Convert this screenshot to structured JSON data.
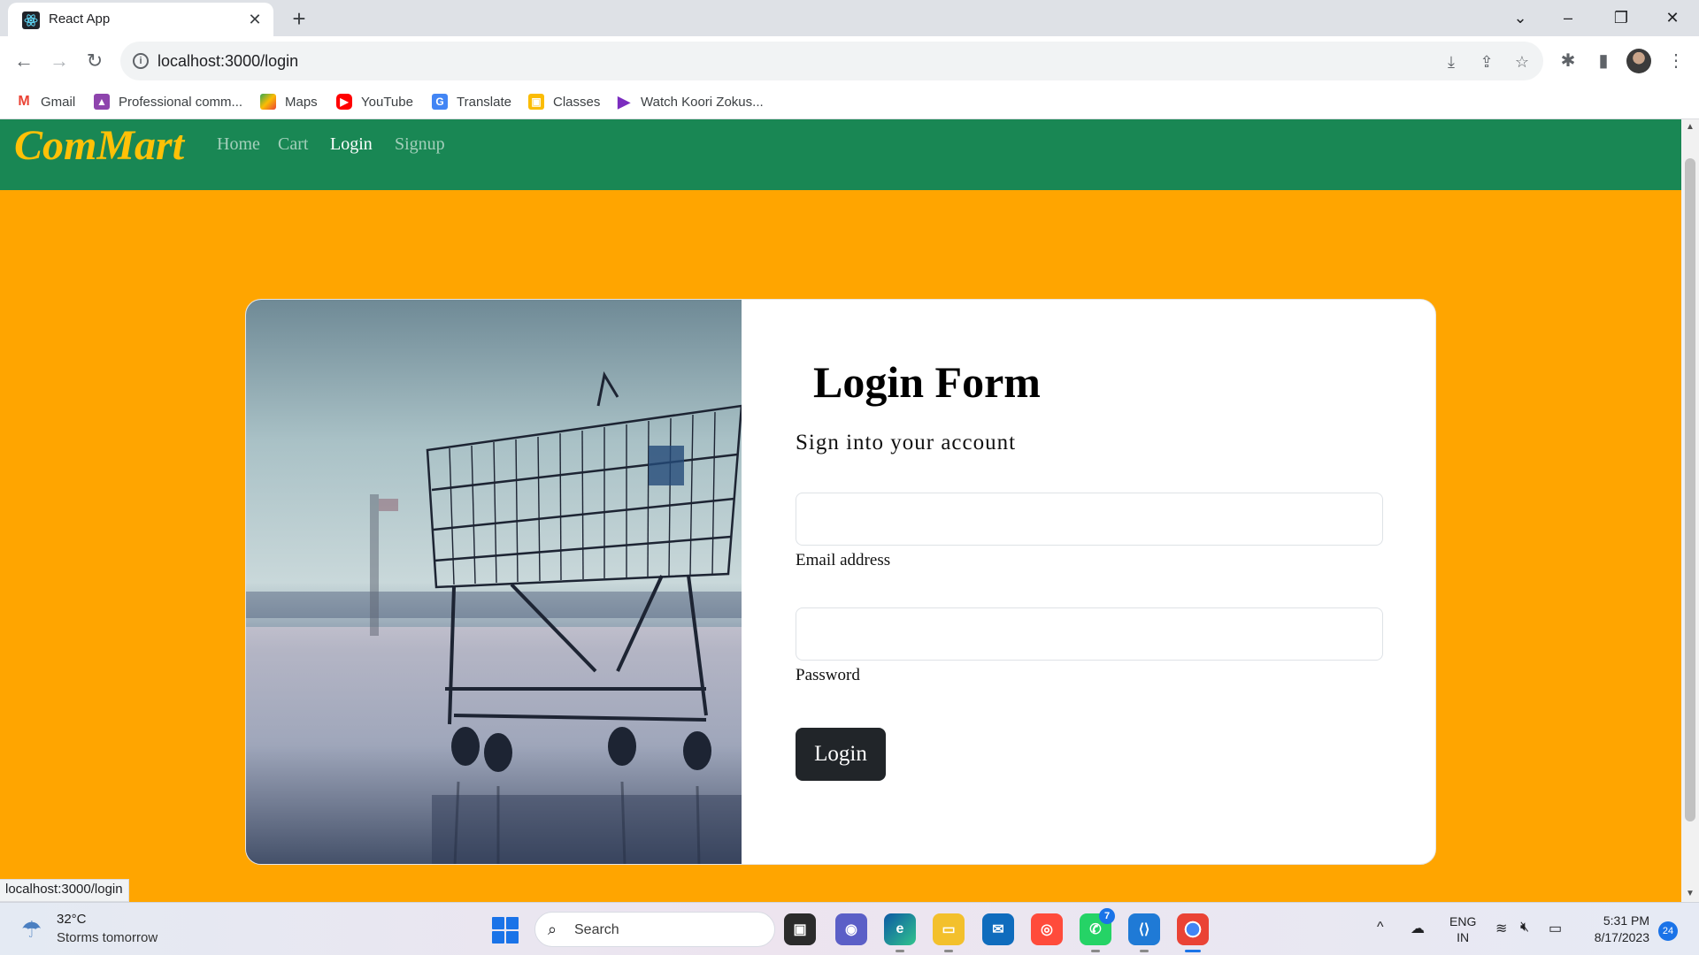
{
  "browser": {
    "tab_title": "React App",
    "url": "localhost:3000/login",
    "bookmarks": [
      {
        "label": "Gmail",
        "icon": "gmail-icon",
        "color": "#ea4335"
      },
      {
        "label": "Professional comm...",
        "icon": "professional-comm-icon",
        "color": "#8e44ad"
      },
      {
        "label": "Maps",
        "icon": "maps-icon",
        "color": "#34a853"
      },
      {
        "label": "YouTube",
        "icon": "youtube-icon",
        "color": "#ff0000"
      },
      {
        "label": "Translate",
        "icon": "translate-icon",
        "color": "#4285f4"
      },
      {
        "label": "Classes",
        "icon": "classes-icon",
        "color": "#fbbc04"
      },
      {
        "label": "Watch Koori Zokus...",
        "icon": "play-icon",
        "color": "#7b2cbf"
      }
    ],
    "status_url": "localhost:3000/login"
  },
  "navbar": {
    "brand": "ComMart",
    "links": [
      "Home",
      "Cart",
      "Login",
      "Signup"
    ],
    "active": "Login",
    "bg_color": "#198754",
    "brand_color": "#ffc107"
  },
  "login": {
    "title": "Login Form",
    "subtitle": "Sign into your account",
    "email_label": "Email address",
    "email_value": "",
    "password_label": "Password",
    "password_value": "",
    "button_label": "Login",
    "page_bg": "#ffa500"
  },
  "taskbar": {
    "weather_temp": "32°C",
    "weather_desc": "Storms tomorrow",
    "search_placeholder": "Search",
    "whatsapp_badge": "7",
    "lang_line1": "ENG",
    "lang_line2": "IN",
    "time": "5:31 PM",
    "date": "8/17/2023",
    "notification_count": "24"
  }
}
